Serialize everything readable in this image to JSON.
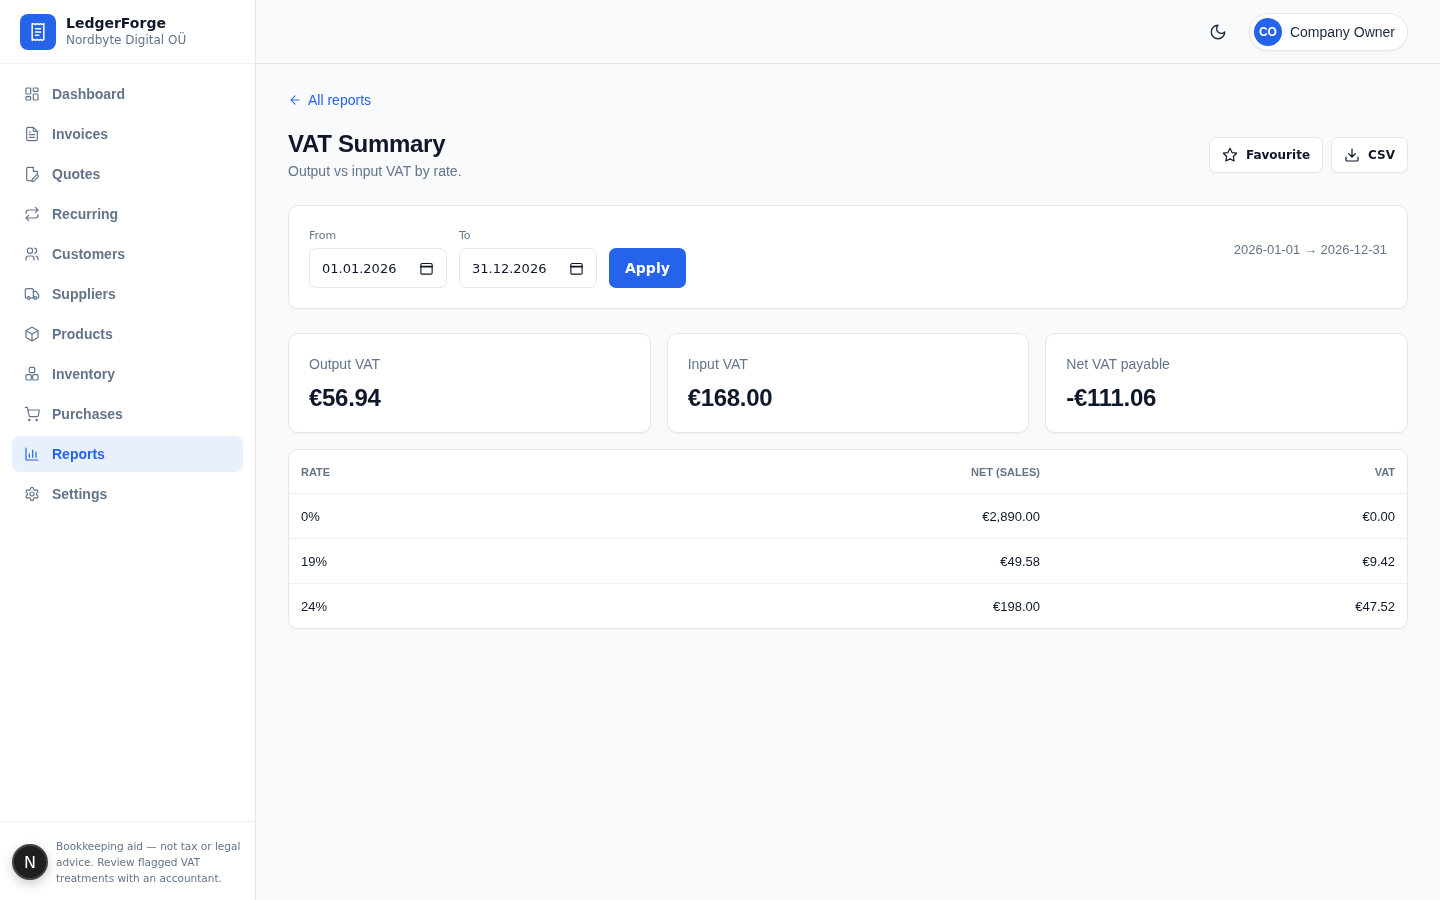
{
  "app": {
    "name": "LedgerForge",
    "company": "Nordbyte Digital OÜ"
  },
  "sidebar": {
    "items": [
      {
        "label": "Dashboard",
        "selected": false
      },
      {
        "label": "Invoices",
        "selected": false
      },
      {
        "label": "Quotes",
        "selected": false
      },
      {
        "label": "Recurring",
        "selected": false
      },
      {
        "label": "Customers",
        "selected": false
      },
      {
        "label": "Suppliers",
        "selected": false
      },
      {
        "label": "Products",
        "selected": false
      },
      {
        "label": "Inventory",
        "selected": false
      },
      {
        "label": "Purchases",
        "selected": false
      },
      {
        "label": "Reports",
        "selected": true
      },
      {
        "label": "Settings",
        "selected": false
      }
    ],
    "disclaimer": "Bookkeeping aid — not tax or legal advice. Review flagged VAT treatments with an accountant."
  },
  "topbar": {
    "user": {
      "initials": "CO",
      "name": "Company Owner"
    }
  },
  "page": {
    "back_link": "All reports",
    "title": "VAT Summary",
    "subtitle": "Output vs input VAT by rate.",
    "actions": [
      "Favourite",
      "CSV"
    ]
  },
  "filter": {
    "from": {
      "label": "From",
      "value": "01.01.2026"
    },
    "to": {
      "label": "To",
      "value": "31.12.2026"
    },
    "apply_button": "Apply",
    "range": "2026-01-01 → 2026-12-31"
  },
  "stats": [
    {
      "label": "Output VAT",
      "value": "€56.94"
    },
    {
      "label": "Input VAT",
      "value": "€168.00"
    },
    {
      "label": "Net VAT payable",
      "value": "-€111.06"
    }
  ],
  "table": {
    "columns": [
      "RATE",
      "NET (SALES)",
      "VAT"
    ],
    "rows": [
      [
        "0%",
        "€2,890.00",
        "€0.00"
      ],
      [
        "19%",
        "€49.58",
        "€9.42"
      ],
      [
        "24%",
        "€198.00",
        "€47.52"
      ]
    ]
  },
  "dev_badge": "N"
}
